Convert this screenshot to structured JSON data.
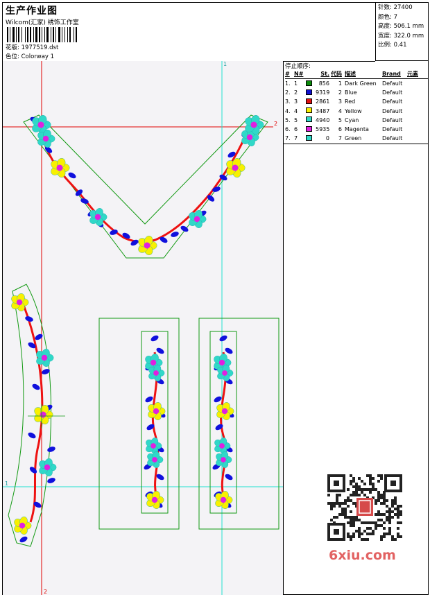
{
  "header": {
    "title": "生产作业图",
    "studio": "Wilcom(汇家) 绣饰工作室",
    "design_label": "花版: 1977519.dst",
    "colorway_label": "色位: Colorway 1"
  },
  "stats": {
    "stitches": "针数: 27400",
    "colors": "颜色: 7",
    "height": "高度: 506.1 mm",
    "width": "宽度: 322.0 mm",
    "scale": "比例: 0.41"
  },
  "stop_sequence": {
    "title": "停止顺序:",
    "headers": [
      "#",
      "N#",
      "St.",
      "代码",
      "描述",
      "Brand",
      "元素"
    ],
    "rows": [
      {
        "idx": "1.",
        "no": "1",
        "color": "#0a8a0a",
        "st": "856",
        "code": "1",
        "desc": "Dark Green",
        "brand": "Default"
      },
      {
        "idx": "2.",
        "no": "2",
        "color": "#1010d0",
        "st": "9319",
        "code": "2",
        "desc": "Blue",
        "brand": "Default"
      },
      {
        "idx": "3.",
        "no": "3",
        "color": "#e01010",
        "st": "2861",
        "code": "3",
        "desc": "Red",
        "brand": "Default"
      },
      {
        "idx": "4.",
        "no": "4",
        "color": "#f8f000",
        "st": "3487",
        "code": "4",
        "desc": "Yellow",
        "brand": "Default"
      },
      {
        "idx": "5.",
        "no": "5",
        "color": "#30d8c8",
        "st": "4940",
        "code": "5",
        "desc": "Cyan",
        "brand": "Default"
      },
      {
        "idx": "6.",
        "no": "6",
        "color": "#e020e0",
        "st": "5935",
        "code": "6",
        "desc": "Magenta",
        "brand": "Default"
      },
      {
        "idx": "7.",
        "no": "7",
        "color": "#30d8c8",
        "st": "0",
        "code": "7",
        "desc": "Green",
        "brand": "Default"
      }
    ]
  },
  "canvas": {
    "guide_labels": {
      "top_cyan": "1",
      "right_red": "2",
      "left_cyan": "1",
      "bottom_red": "2"
    }
  },
  "watermark": {
    "logo_text": "6xiu.com"
  },
  "colors": {
    "outline": "#119911",
    "guide_red": "#e00000",
    "guide_cyan": "#20e0d0",
    "stem": "#ee1111",
    "leaf": "#1010dd",
    "petal_cyan": "#30d8c8",
    "petal_yellow": "#f8f000",
    "center": "#e020e0"
  }
}
